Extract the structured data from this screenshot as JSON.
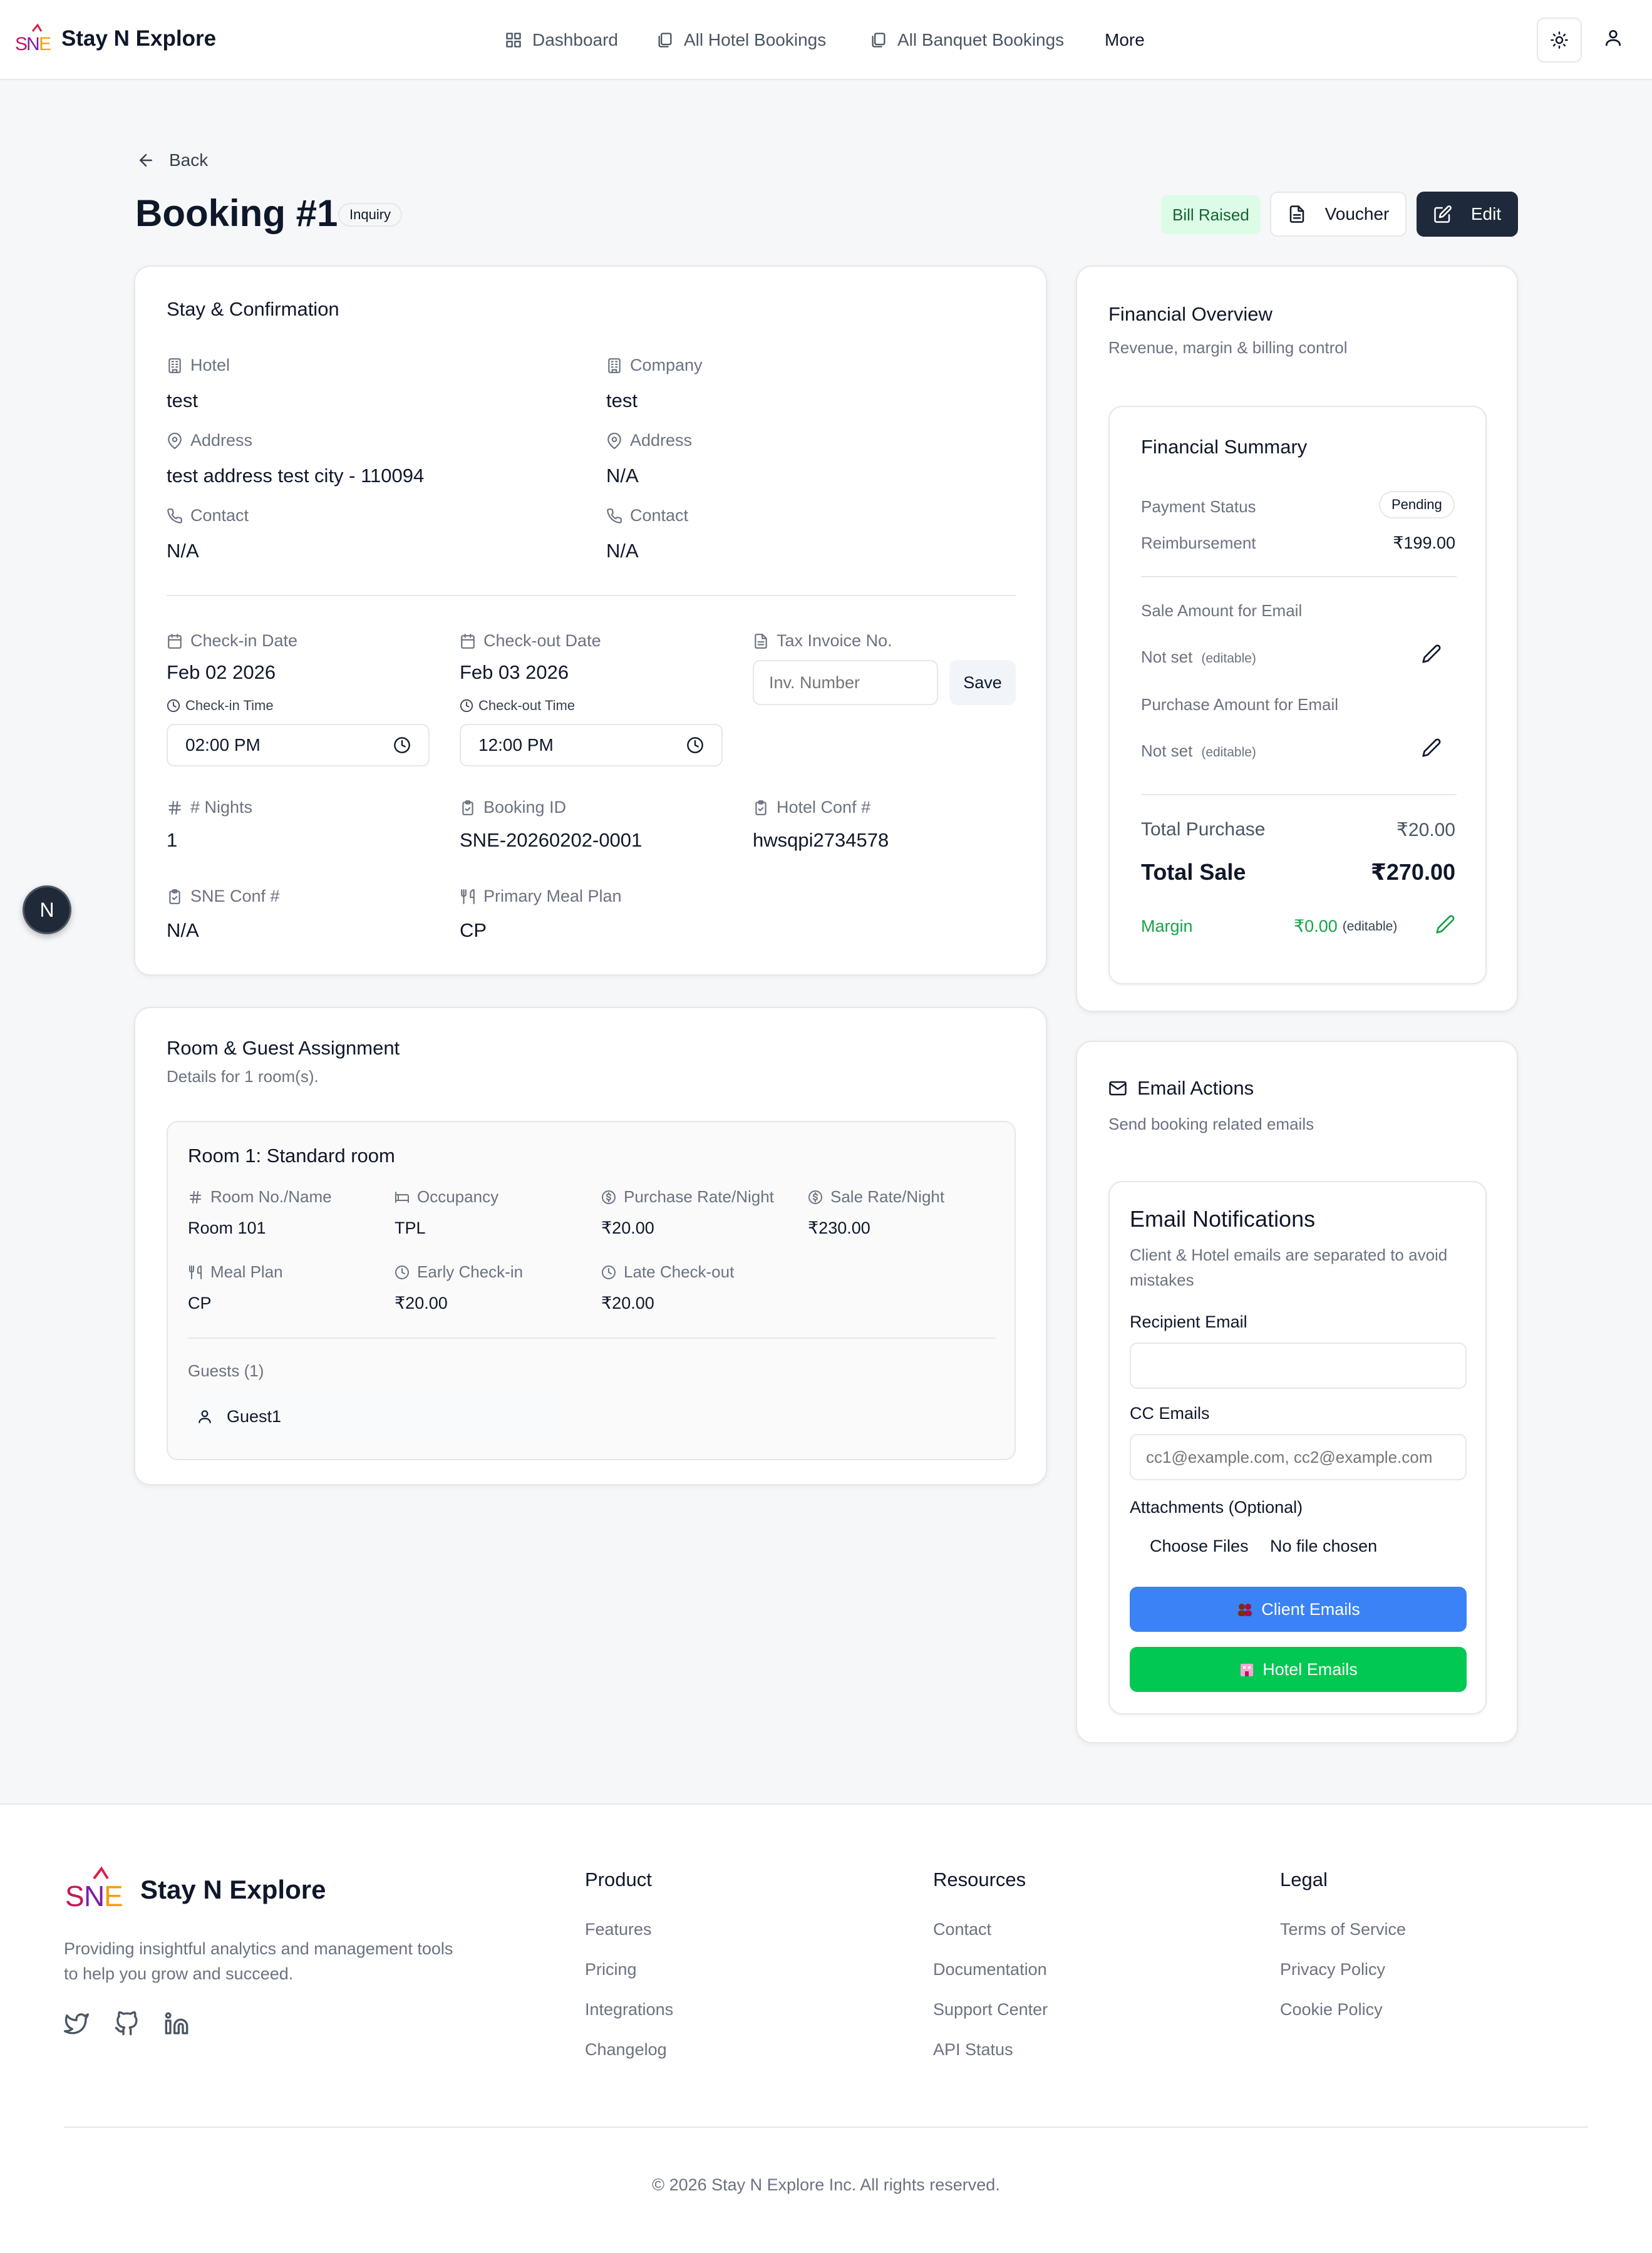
{
  "brand": {
    "name": "Stay N Explore",
    "logo_text": "SNE"
  },
  "nav": {
    "items": [
      {
        "label": "Dashboard",
        "icon": "dashboard-icon"
      },
      {
        "label": "All Hotel Bookings",
        "icon": "bookings-icon"
      },
      {
        "label": "All Banquet Bookings",
        "icon": "bookings-icon"
      },
      {
        "label": "More"
      }
    ]
  },
  "header_actions": {
    "theme_icon": "sun-icon",
    "user_icon": "user-icon"
  },
  "page": {
    "back": "Back",
    "title": "Booking #1",
    "status_badge": "Inquiry",
    "bill_badge": "Bill Raised",
    "voucher_label": "Voucher",
    "edit_label": "Edit"
  },
  "stay": {
    "title": "Stay & Confirmation",
    "hotel_label": "Hotel",
    "hotel_value": "test",
    "company_label": "Company",
    "company_value": "test",
    "address_label": "Address",
    "address_value": "test address test city - 110094",
    "company_address_label": "Address",
    "company_address_value": "N/A",
    "contact_label": "Contact",
    "contact_value": "N/A",
    "company_contact_label": "Contact",
    "company_contact_value": "N/A",
    "checkin_label": "Check-in Date",
    "checkin_value": "Feb 02 2026",
    "checkout_label": "Check-out Date",
    "checkout_value": "Feb 03 2026",
    "tax_label": "Tax Invoice No.",
    "tax_placeholder": "Inv. Number",
    "save_label": "Save",
    "checkin_time_label": "Check-in Time",
    "checkin_time_value": "02:00 PM",
    "checkout_time_label": "Check-out Time",
    "checkout_time_value": "12:00 PM",
    "nights_label": "# Nights",
    "nights_value": "1",
    "booking_id_label": "Booking ID",
    "booking_id_value": "SNE-20260202-0001",
    "hotel_conf_label": "Hotel Conf #",
    "hotel_conf_value": "hwsqpi2734578",
    "sne_conf_label": "SNE Conf #",
    "sne_conf_value": "N/A",
    "meal_label": "Primary Meal Plan",
    "meal_value": "CP"
  },
  "rooms": {
    "title": "Room & Guest Assignment",
    "subtitle": "Details for 1 room(s).",
    "room": {
      "title": "Room 1: Standard room",
      "no_label": "Room No./Name",
      "no_value": "Room 101",
      "occ_label": "Occupancy",
      "occ_value": "TPL",
      "prate_label": "Purchase Rate/Night",
      "prate_value": "₹20.00",
      "srate_label": "Sale Rate/Night",
      "srate_value": "₹230.00",
      "meal_label": "Meal Plan",
      "meal_value": "CP",
      "early_label": "Early Check-in",
      "early_value": "₹20.00",
      "late_label": "Late Check-out",
      "late_value": "₹20.00"
    },
    "guests_label": "Guests (1)",
    "guests": [
      "Guest1"
    ]
  },
  "finance": {
    "title": "Financial Overview",
    "subtitle": "Revenue, margin & billing control",
    "summary_title": "Financial Summary",
    "payment_status_label": "Payment Status",
    "payment_status_value": "Pending",
    "reimb_label": "Reimbursement",
    "reimb_value": "₹199.00",
    "sale_email_label": "Sale Amount for Email",
    "sale_email_value": "Not set",
    "sale_email_hint": "(editable)",
    "purchase_email_label": "Purchase Amount for Email",
    "purchase_email_value": "Not set",
    "purchase_email_hint": "(editable)",
    "total_purchase_label": "Total Purchase",
    "total_purchase_value": "₹20.00",
    "total_sale_label": "Total Sale",
    "total_sale_value": "₹270.00",
    "margin_label": "Margin",
    "margin_value": "₹0.00",
    "margin_hint": "(editable)",
    "margin_color": "#16a34a"
  },
  "email": {
    "title": "Email Actions",
    "subtitle": "Send booking related emails",
    "notif_title": "Email Notifications",
    "notif_sub": "Client & Hotel emails are separated to avoid mistakes",
    "recipient_label": "Recipient Email",
    "recipient_value": "",
    "cc_label": "CC Emails",
    "cc_placeholder": "cc1@example.com, cc2@example.com",
    "attach_label": "Attachments (Optional)",
    "choose_label": "Choose Files",
    "no_file": "No file chosen",
    "client_btn": "Client Emails",
    "hotel_btn": "Hotel Emails",
    "client_color": "#3b82f6",
    "hotel_color": "#00c853"
  },
  "floating": {
    "badge": "N"
  },
  "footer": {
    "brand": "Stay N Explore",
    "tagline": "Providing insightful analytics and management tools to help you grow and succeed.",
    "social": [
      "twitter-icon",
      "github-icon",
      "linkedin-icon"
    ],
    "cols": [
      {
        "title": "Product",
        "links": [
          "Features",
          "Pricing",
          "Integrations",
          "Changelog"
        ]
      },
      {
        "title": "Resources",
        "links": [
          "Contact",
          "Documentation",
          "Support Center",
          "API Status"
        ]
      },
      {
        "title": "Legal",
        "links": [
          "Terms of Service",
          "Privacy Policy",
          "Cookie Policy"
        ]
      }
    ],
    "copyright": "© 2026 Stay N Explore Inc. All rights reserved."
  }
}
